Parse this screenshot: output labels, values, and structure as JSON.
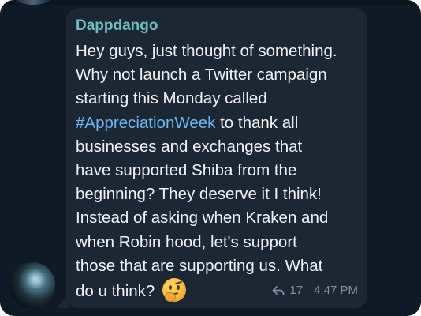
{
  "message": {
    "sender": "Dappdango",
    "lines": [
      "Hey guys, just thought of something.",
      "Why not launch a Twitter campaign",
      "starting this Monday called",
      "#AppreciationWeek",
      " to thank all",
      "businesses and exchanges that",
      "have supported Shiba from the",
      "beginning? They deserve it I think!",
      "Instead of asking when Kraken and",
      "when Robin hood, let's support",
      "those that are supporting us. What",
      "do u think? "
    ],
    "emoji": "thinking-face-icon",
    "reply_count": "17",
    "time": "4:47 PM"
  },
  "colors": {
    "background": "#0f1a26",
    "bubble": "#1c2734",
    "sender": "#6cc0c0",
    "hashtag": "#6cb7f5",
    "text": "#f0f3f6",
    "meta": "#7f8fa1"
  }
}
